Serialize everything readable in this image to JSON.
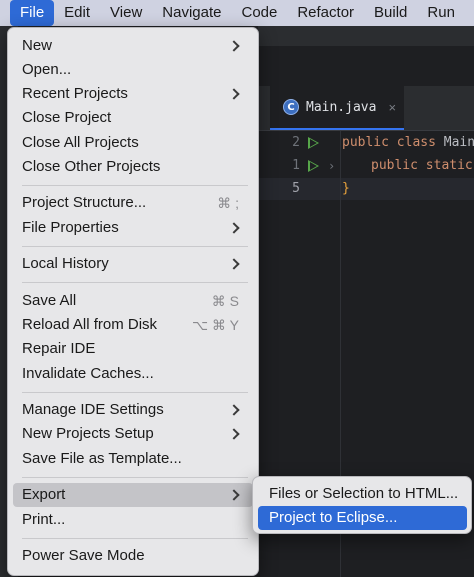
{
  "menubar": {
    "items": [
      "File",
      "Edit",
      "View",
      "Navigate",
      "Code",
      "Refactor",
      "Build",
      "Run"
    ],
    "active": "File"
  },
  "editor": {
    "tab_label": "Main.java",
    "tab_icon_letter": "C",
    "tab_close": "×",
    "lines": [
      {
        "num": "2",
        "code_kw": "public class",
        "code_rest": " Main"
      },
      {
        "num": "1",
        "code_kw": "public static",
        "code_rest": " v"
      },
      {
        "num": "5",
        "code_brace": "}"
      }
    ]
  },
  "file_menu": {
    "items": [
      {
        "label": "New",
        "submenu": true
      },
      {
        "label": "Open..."
      },
      {
        "label": "Recent Projects",
        "submenu": true
      },
      {
        "label": "Close Project"
      },
      {
        "label": "Close All Projects"
      },
      {
        "label": "Close Other Projects"
      },
      {
        "label": "Project Structure...",
        "shortcut": "⌘ ;"
      },
      {
        "label": "File Properties",
        "submenu": true
      },
      {
        "label": "Local History",
        "submenu": true
      },
      {
        "label": "Save All",
        "shortcut": "⌘ S"
      },
      {
        "label": "Reload All from Disk",
        "shortcut": "⌥ ⌘ Y"
      },
      {
        "label": "Repair IDE"
      },
      {
        "label": "Invalidate Caches..."
      },
      {
        "label": "Manage IDE Settings",
        "submenu": true
      },
      {
        "label": "New Projects Setup",
        "submenu": true
      },
      {
        "label": "Save File as Template..."
      },
      {
        "label": "Export",
        "submenu": true,
        "highlighted": true
      },
      {
        "label": "Print..."
      },
      {
        "label": "Power Save Mode"
      }
    ]
  },
  "export_submenu": {
    "items": [
      {
        "label": "Files or Selection to HTML..."
      },
      {
        "label": "Project to Eclipse...",
        "selected": true
      }
    ]
  },
  "colors": {
    "menubar_bg": "#cfd2e1",
    "accent": "#2e6ad6",
    "menu_bg": "#e7e7e9",
    "editor_bg": "#1e1f22"
  }
}
